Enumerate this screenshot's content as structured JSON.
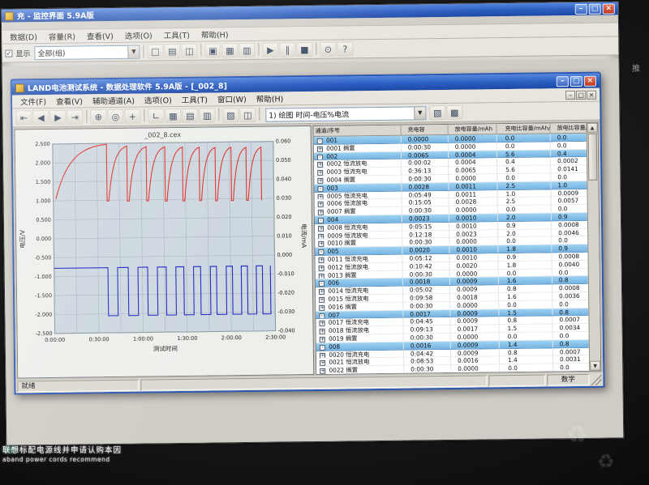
{
  "bezel": {
    "side_label": "推",
    "sticker_line1": "联想标配电源线并申请认购本因",
    "sticker_line2": "aband power cords recommend"
  },
  "monitor_app": {
    "title": "充 - 监控界面 5.9A版",
    "menus": [
      "数据(D)",
      "容量(R)",
      "查看(V)",
      "选项(O)",
      "工具(T)",
      "帮助(H)"
    ],
    "toolbar": {
      "display_label": "显示",
      "scope_value": "全部(组)",
      "icons": [
        "new-icon",
        "open-icon",
        "save-icon",
        "sep",
        "monitor-icon",
        "chart-icon",
        "table-icon",
        "sep",
        "start-icon",
        "pause-icon",
        "stop-icon",
        "sep",
        "settings-icon",
        "help-icon"
      ]
    },
    "window_buttons": [
      "minimize",
      "maximize",
      "close"
    ]
  },
  "main_window": {
    "title": "LAND电池测试系统 - 数据处理软件 5.9A版 - [_002_8]",
    "menus": [
      "文件(F)",
      "查看(V)",
      "辅助通道(A)",
      "选项(O)",
      "工具(T)",
      "窗口(W)",
      "帮助(H)"
    ],
    "toolbar": {
      "view_selector": "1) 绘图 时间-电压%电流",
      "icons_left": [
        "first-icon",
        "prev-icon",
        "next-icon",
        "last-icon",
        "sep",
        "zoom-icon",
        "pan-icon",
        "crosshair-icon",
        "sep",
        "axes-icon",
        "grid-icon",
        "legend-icon",
        "table-icon",
        "sep",
        "palette-icon",
        "copy-icon",
        "sep"
      ],
      "icons_right": [
        "export-icon",
        "print-icon"
      ]
    },
    "window_buttons": [
      "minimize",
      "restore",
      "close"
    ],
    "child_buttons": [
      "minimize",
      "restore",
      "close"
    ],
    "statusbar": {
      "ready": "就绪",
      "mode": "数字"
    }
  },
  "chart_data": {
    "type": "line",
    "title": "_002_8.cex",
    "xlabel": "测试时间",
    "ylabel_left": "电压/V",
    "ylabel_right": "电流/mA",
    "x_range_hours": [
      0,
      2.5
    ],
    "y_left_range": [
      -2.5,
      2.5
    ],
    "x_tick_hours": [
      0,
      0.5,
      1,
      1.5,
      2,
      2.5
    ],
    "x_tick_labels": [
      "0:00:00",
      "0:30:00",
      "1:00:00",
      "1:30:00",
      "2:00:00",
      "2:30:00"
    ],
    "y_left_tick_labels": [
      "2.500",
      "2.000",
      "1.500",
      "1.000",
      "0.500",
      "0.000",
      "-0.500",
      "-1.000",
      "-1.500",
      "-2.000",
      "-2.500"
    ],
    "y_right_tick_labels": [
      "0.060",
      "0.050",
      "0.040",
      "0.030",
      "0.020",
      "0.010",
      "0.000",
      "-0.010",
      "-0.020",
      "-0.030",
      "-0.040"
    ],
    "grid": true,
    "legend": "none",
    "series": [
      {
        "name": "电压",
        "color": "#e03028",
        "axis": "left",
        "shape": "charge-arcs",
        "arcs": [
          {
            "t0": 0.03,
            "t1": 0.61,
            "v0": 1.05,
            "v1": 2.48
          },
          {
            "t0": 0.63,
            "t1": 0.84,
            "v0": 0.98,
            "v1": 2.42
          },
          {
            "t0": 0.86,
            "t1": 1.06,
            "v0": 0.97,
            "v1": 2.4
          },
          {
            "t0": 1.08,
            "t1": 1.27,
            "v0": 0.97,
            "v1": 2.39
          },
          {
            "t0": 1.29,
            "t1": 1.47,
            "v0": 0.96,
            "v1": 2.38
          },
          {
            "t0": 1.49,
            "t1": 1.66,
            "v0": 0.96,
            "v1": 2.37
          },
          {
            "t0": 1.68,
            "t1": 1.84,
            "v0": 0.96,
            "v1": 2.36
          },
          {
            "t0": 1.86,
            "t1": 2.02,
            "v0": 0.95,
            "v1": 2.36
          },
          {
            "t0": 2.04,
            "t1": 2.19,
            "v0": 0.95,
            "v1": 2.35
          },
          {
            "t0": 2.21,
            "t1": 2.36,
            "v0": 0.95,
            "v1": 2.35
          }
        ]
      },
      {
        "name": "电流",
        "color": "#2028c8",
        "axis": "left",
        "shape": "square-wave",
        "high_level": -0.78,
        "low_level": -2.05,
        "x_end": 2.45,
        "low_windows": [
          [
            0.61,
            0.72
          ],
          [
            0.84,
            0.95
          ],
          [
            1.06,
            1.17
          ],
          [
            1.27,
            1.38
          ],
          [
            1.47,
            1.58
          ],
          [
            1.66,
            1.77
          ],
          [
            1.84,
            1.95
          ],
          [
            2.02,
            2.12
          ],
          [
            2.19,
            2.29
          ],
          [
            2.36,
            2.45
          ]
        ]
      }
    ]
  },
  "table": {
    "headers": [
      "通道/序号",
      "充电容",
      "放电容量/mAh",
      "充电比容量/mAh/g",
      "放电比容量/mAh/g"
    ],
    "cycles": [
      {
        "id": "001",
        "cap1": "0.0000",
        "cap2": "0.0000",
        "r1": "0.0",
        "r2": "0.0",
        "steps": [
          {
            "id": "0001",
            "name": "搁置",
            "time": "0:00:30",
            "cap": "0.0000",
            "r1": "0.0",
            "r2": "0.0"
          }
        ]
      },
      {
        "id": "002",
        "cap1": "0.0065",
        "cap2": "0.0004",
        "r1": "5.6",
        "r2": "0.4",
        "steps": [
          {
            "id": "0002",
            "name": "恒流放电",
            "time": "0:00:02",
            "cap": "0.0004",
            "r1": "0.4",
            "r2": "0.0002"
          },
          {
            "id": "0003",
            "name": "恒流充电",
            "time": "0:36:13",
            "cap": "0.0065",
            "r1": "5.6",
            "r2": "0.0141"
          },
          {
            "id": "0004",
            "name": "搁置",
            "time": "0:00:30",
            "cap": "0.0000",
            "r1": "0.0",
            "r2": "0.0"
          }
        ]
      },
      {
        "id": "003",
        "cap1": "0.0028",
        "cap2": "0.0011",
        "r1": "2.5",
        "r2": "1.0",
        "steps": [
          {
            "id": "0005",
            "name": "恒流充电",
            "time": "0:05:49",
            "cap": "0.0011",
            "r1": "1.0",
            "r2": "0.0009"
          },
          {
            "id": "0006",
            "name": "恒流放电",
            "time": "0:15:05",
            "cap": "0.0028",
            "r1": "2.5",
            "r2": "0.0057"
          },
          {
            "id": "0007",
            "name": "搁置",
            "time": "0:00:30",
            "cap": "0.0000",
            "r1": "0.0",
            "r2": "0.0"
          }
        ]
      },
      {
        "id": "004",
        "cap1": "0.0023",
        "cap2": "0.0010",
        "r1": "2.0",
        "r2": "0.9",
        "steps": [
          {
            "id": "0008",
            "name": "恒流充电",
            "time": "0:05:15",
            "cap": "0.0010",
            "r1": "0.9",
            "r2": "0.0008"
          },
          {
            "id": "0009",
            "name": "恒流放电",
            "time": "0:12:18",
            "cap": "0.0023",
            "r1": "2.0",
            "r2": "0.0046"
          },
          {
            "id": "0010",
            "name": "搁置",
            "time": "0:00:30",
            "cap": "0.0000",
            "r1": "0.0",
            "r2": "0.0"
          }
        ]
      },
      {
        "id": "005",
        "cap1": "0.0020",
        "cap2": "0.0010",
        "r1": "1.8",
        "r2": "0.9",
        "steps": [
          {
            "id": "0011",
            "name": "恒流充电",
            "time": "0:05:12",
            "cap": "0.0010",
            "r1": "0.9",
            "r2": "0.0008"
          },
          {
            "id": "0012",
            "name": "恒流放电",
            "time": "0:10:42",
            "cap": "0.0020",
            "r1": "1.8",
            "r2": "0.0040"
          },
          {
            "id": "0013",
            "name": "搁置",
            "time": "0:00:30",
            "cap": "0.0000",
            "r1": "0.0",
            "r2": "0.0"
          }
        ]
      },
      {
        "id": "006",
        "cap1": "0.0018",
        "cap2": "0.0009",
        "r1": "1.6",
        "r2": "0.8",
        "steps": [
          {
            "id": "0014",
            "name": "恒流充电",
            "time": "0:05:02",
            "cap": "0.0009",
            "r1": "0.8",
            "r2": "0.0008"
          },
          {
            "id": "0015",
            "name": "恒流放电",
            "time": "0:09:58",
            "cap": "0.0018",
            "r1": "1.6",
            "r2": "0.0036"
          },
          {
            "id": "0016",
            "name": "搁置",
            "time": "0:00:30",
            "cap": "0.0000",
            "r1": "0.0",
            "r2": "0.0"
          }
        ]
      },
      {
        "id": "007",
        "cap1": "0.0017",
        "cap2": "0.0009",
        "r1": "1.5",
        "r2": "0.8",
        "steps": [
          {
            "id": "0017",
            "name": "恒流充电",
            "time": "0:04:45",
            "cap": "0.0009",
            "r1": "0.8",
            "r2": "0.0007"
          },
          {
            "id": "0018",
            "name": "恒流放电",
            "time": "0:09:13",
            "cap": "0.0017",
            "r1": "1.5",
            "r2": "0.0034"
          },
          {
            "id": "0019",
            "name": "搁置",
            "time": "0:00:30",
            "cap": "0.0000",
            "r1": "0.0",
            "r2": "0.0"
          }
        ]
      },
      {
        "id": "008",
        "cap1": "0.0016",
        "cap2": "0.0009",
        "r1": "1.4",
        "r2": "0.8",
        "steps": [
          {
            "id": "0020",
            "name": "恒流充电",
            "time": "0:04:42",
            "cap": "0.0009",
            "r1": "0.8",
            "r2": "0.0007"
          },
          {
            "id": "0021",
            "name": "恒流放电",
            "time": "0:08:53",
            "cap": "0.0016",
            "r1": "1.4",
            "r2": "0.0031"
          },
          {
            "id": "0022",
            "name": "搁置",
            "time": "0:00:30",
            "cap": "0.0000",
            "r1": "0.0",
            "r2": "0.0"
          }
        ]
      }
    ]
  }
}
